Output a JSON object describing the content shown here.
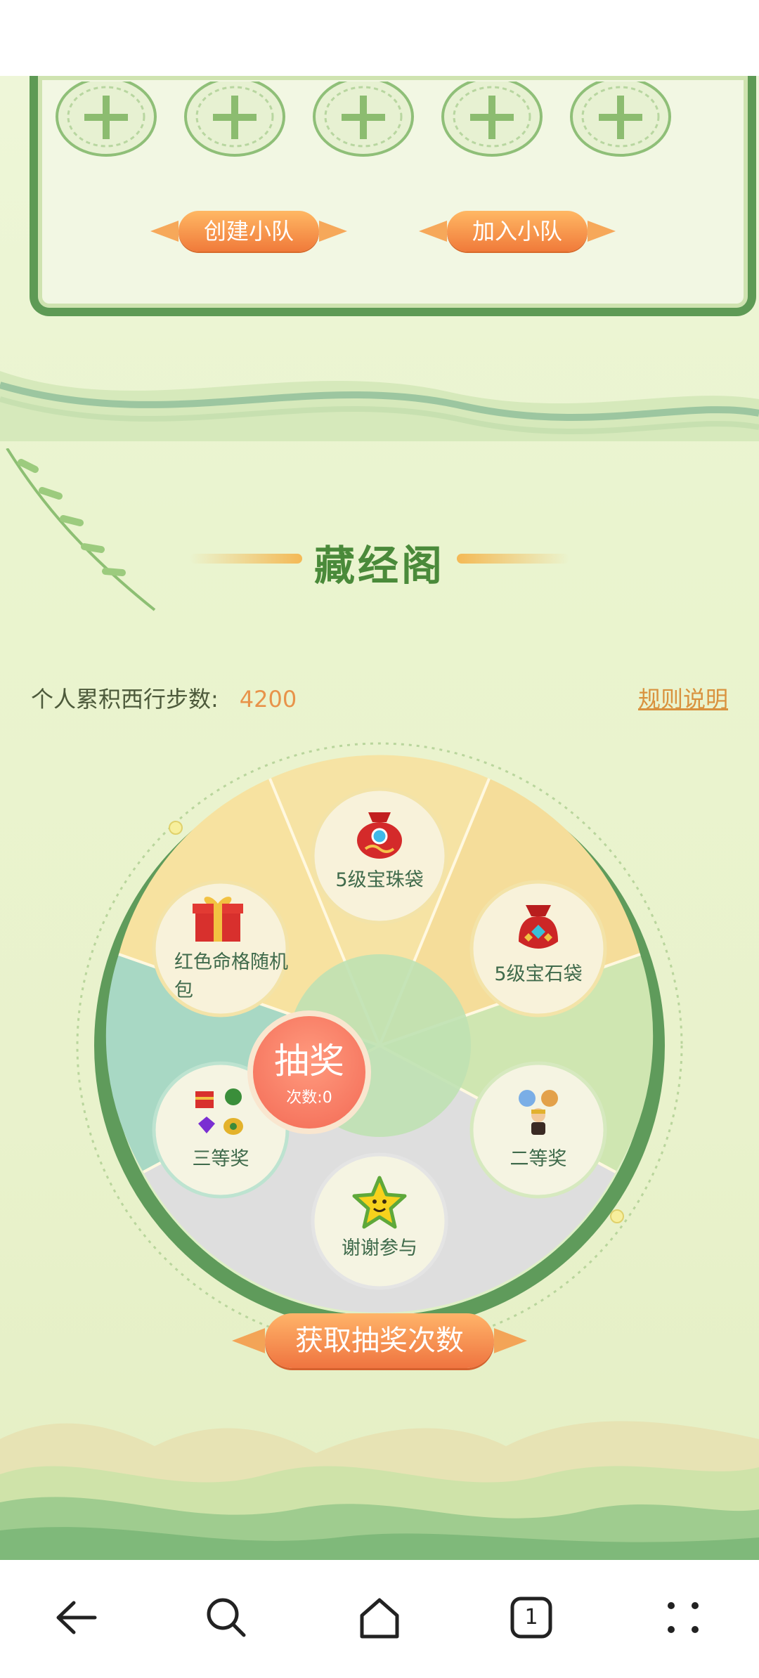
{
  "team": {
    "slots": [
      "add-slot-1",
      "add-slot-2",
      "add-slot-3",
      "add-slot-4",
      "add-slot-5"
    ],
    "create_label": "创建小队",
    "join_label": "加入小队"
  },
  "library": {
    "title": "藏经阁",
    "steps_label": "个人累积西行步数:",
    "steps_value": "4200",
    "rules_label": "规则说明"
  },
  "wheel": {
    "prizes": [
      {
        "label": "5级宝珠袋",
        "icon": "red-orb-bag-icon"
      },
      {
        "label": "5级宝石袋",
        "icon": "gem-bag-icon"
      },
      {
        "label": "二等奖",
        "icon": "figures-icon"
      },
      {
        "label": "谢谢参与",
        "icon": "star-icon"
      },
      {
        "label": "三等奖",
        "icon": "gem-pile-icon"
      },
      {
        "label": "红色命格随机包",
        "icon": "gift-box-icon"
      }
    ],
    "draw_label": "抽奖",
    "count_label": "次数:0"
  },
  "get_draws_label": "获取抽奖次数",
  "nav": {
    "page_count": "1"
  }
}
